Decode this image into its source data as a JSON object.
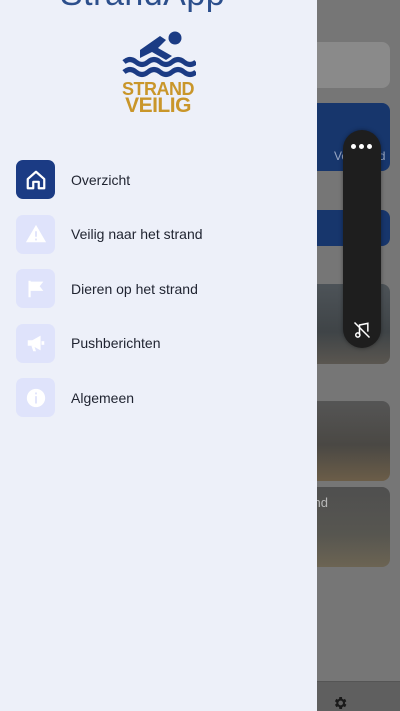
{
  "app": {
    "title": "StrandApp",
    "logo": {
      "line1": "STRAND",
      "line2": "VEILIG"
    }
  },
  "menu": {
    "items": [
      {
        "label": "Overzicht",
        "icon": "home-icon",
        "active": true
      },
      {
        "label": "Veilig naar het strand",
        "icon": "warning-icon",
        "active": false
      },
      {
        "label": "Dieren op het strand",
        "icon": "flag-icon",
        "active": false
      },
      {
        "label": "Pushberichten",
        "icon": "megaphone-icon",
        "active": false
      },
      {
        "label": "Algemeen",
        "icon": "info-icon",
        "active": false
      }
    ]
  },
  "background": {
    "card_text_1": "Veiligheid",
    "card_text_2": "rand"
  },
  "colors": {
    "drawer_bg": "#edf0f9",
    "active_icon_bg": "#1b3b84",
    "inactive_icon_bg": "#dfe3fb",
    "brand_blue": "#1b3b84",
    "brand_gold": "#c9962a"
  }
}
